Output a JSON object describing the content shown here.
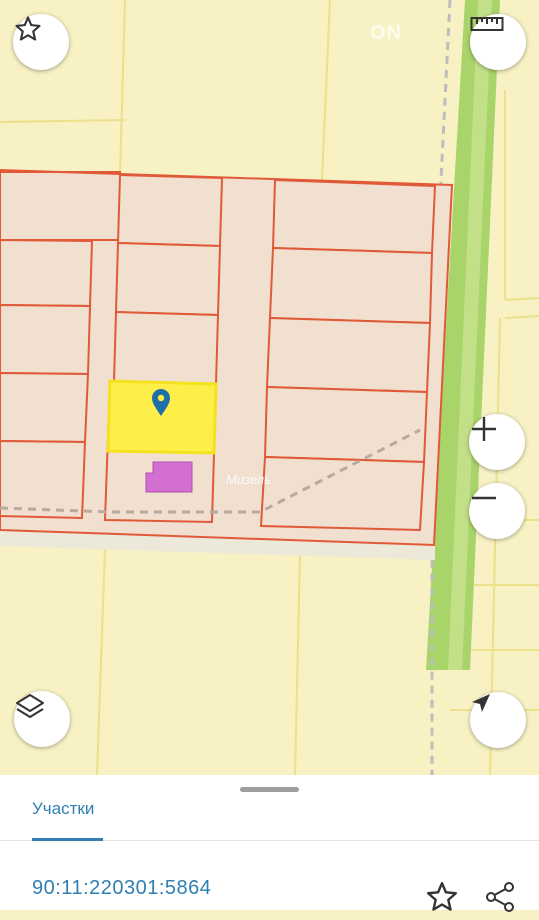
{
  "map": {
    "watermark_top": "ON",
    "watermark_center": "Мизель"
  },
  "icons": {
    "favorite": "star-outline-icon",
    "ruler": "ruler-icon",
    "zoom_in": "plus-icon",
    "zoom_out": "minus-icon",
    "layers": "layers-icon",
    "location": "navigation-arrow-icon",
    "pin": "map-pin-icon",
    "share": "share-icon"
  },
  "colors": {
    "background": "#f7f1c4",
    "parcel_fill": "#f1dfcf",
    "parcel_border": "#e05a3a",
    "selected_fill": "#ffef3a",
    "selected_border": "#f5e21f",
    "building": "#d36fd0",
    "green_strip": "#a9d46a",
    "accent": "#2f7fb3"
  },
  "sheet": {
    "tab_label": "Участки",
    "cadastral_number": "90:11:220301:5864"
  }
}
